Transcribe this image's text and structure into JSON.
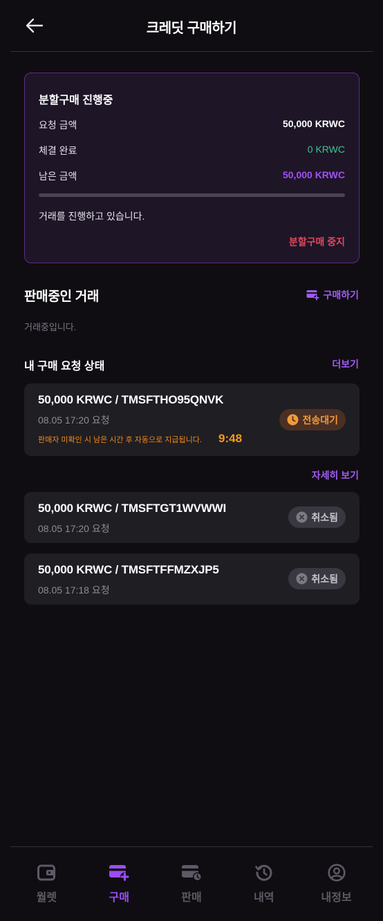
{
  "header": {
    "title": "크레딧 구매하기"
  },
  "split_purchase": {
    "title": "분할구매 진행중",
    "requested_label": "요청 금액",
    "requested_value": "50,000 KRWC",
    "completed_label": "체결 완료",
    "completed_value": "0 KRWC",
    "remaining_label": "남은 금액",
    "remaining_value": "50,000 KRWC",
    "progress_fraction": 0,
    "status_text": "거래를 진행하고 있습니다.",
    "stop_label": "분할구매 중지",
    "colors": {
      "completed": "#3ec48d",
      "remaining": "#a050f5",
      "stop": "#e5475b"
    }
  },
  "selling": {
    "title": "판매중인 거래",
    "buy_link": "구매하기",
    "empty_text": "거래중입니다."
  },
  "my_requests": {
    "title": "내 구매 요청 상태",
    "more_link": "더보기",
    "detail_link": "자세히 보기",
    "items": [
      {
        "title": "50,000 KRWC / TMSFTHO95QNVK",
        "time": "08.05 17:20 요청",
        "note": "판매자 미확인 시 남은 시간 후 자동으로 지급됩니다.",
        "countdown": "9:48",
        "badge": "전송대기",
        "badge_icon": "clock-icon"
      },
      {
        "title": "50,000 KRWC / TMSFTGT1WVWWI",
        "time": "08.05 17:20 요청",
        "badge": "취소됨",
        "badge_icon": "x-circle-icon"
      },
      {
        "title": "50,000 KRWC / TMSFTFFMZXJP5",
        "time": "08.05 17:18 요청",
        "badge": "취소됨",
        "badge_icon": "x-circle-icon"
      }
    ]
  },
  "bottom_nav": {
    "items": [
      {
        "label": "월렛",
        "icon": "wallet-icon",
        "active": false
      },
      {
        "label": "구매",
        "icon": "card-plus-icon",
        "active": true
      },
      {
        "label": "판매",
        "icon": "card-clock-icon",
        "active": false
      },
      {
        "label": "내역",
        "icon": "history-icon",
        "active": false
      },
      {
        "label": "내정보",
        "icon": "user-icon",
        "active": false
      }
    ],
    "colors": {
      "active": "#9b4df5",
      "inactive": "#5e5a65"
    }
  }
}
